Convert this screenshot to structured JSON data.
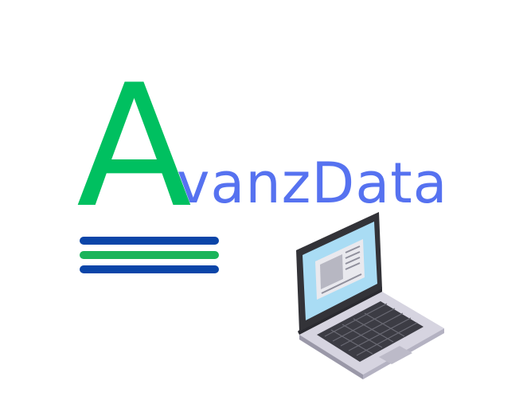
{
  "brand": {
    "initial": "A",
    "rest": "vanzData"
  },
  "colors": {
    "initial": "#00c060",
    "rest": "#5672f0",
    "stripe_blue": "#0b45a8",
    "stripe_green": "#1ab45a"
  },
  "icons": [
    "menu-stripes-icon",
    "laptop-icon"
  ]
}
